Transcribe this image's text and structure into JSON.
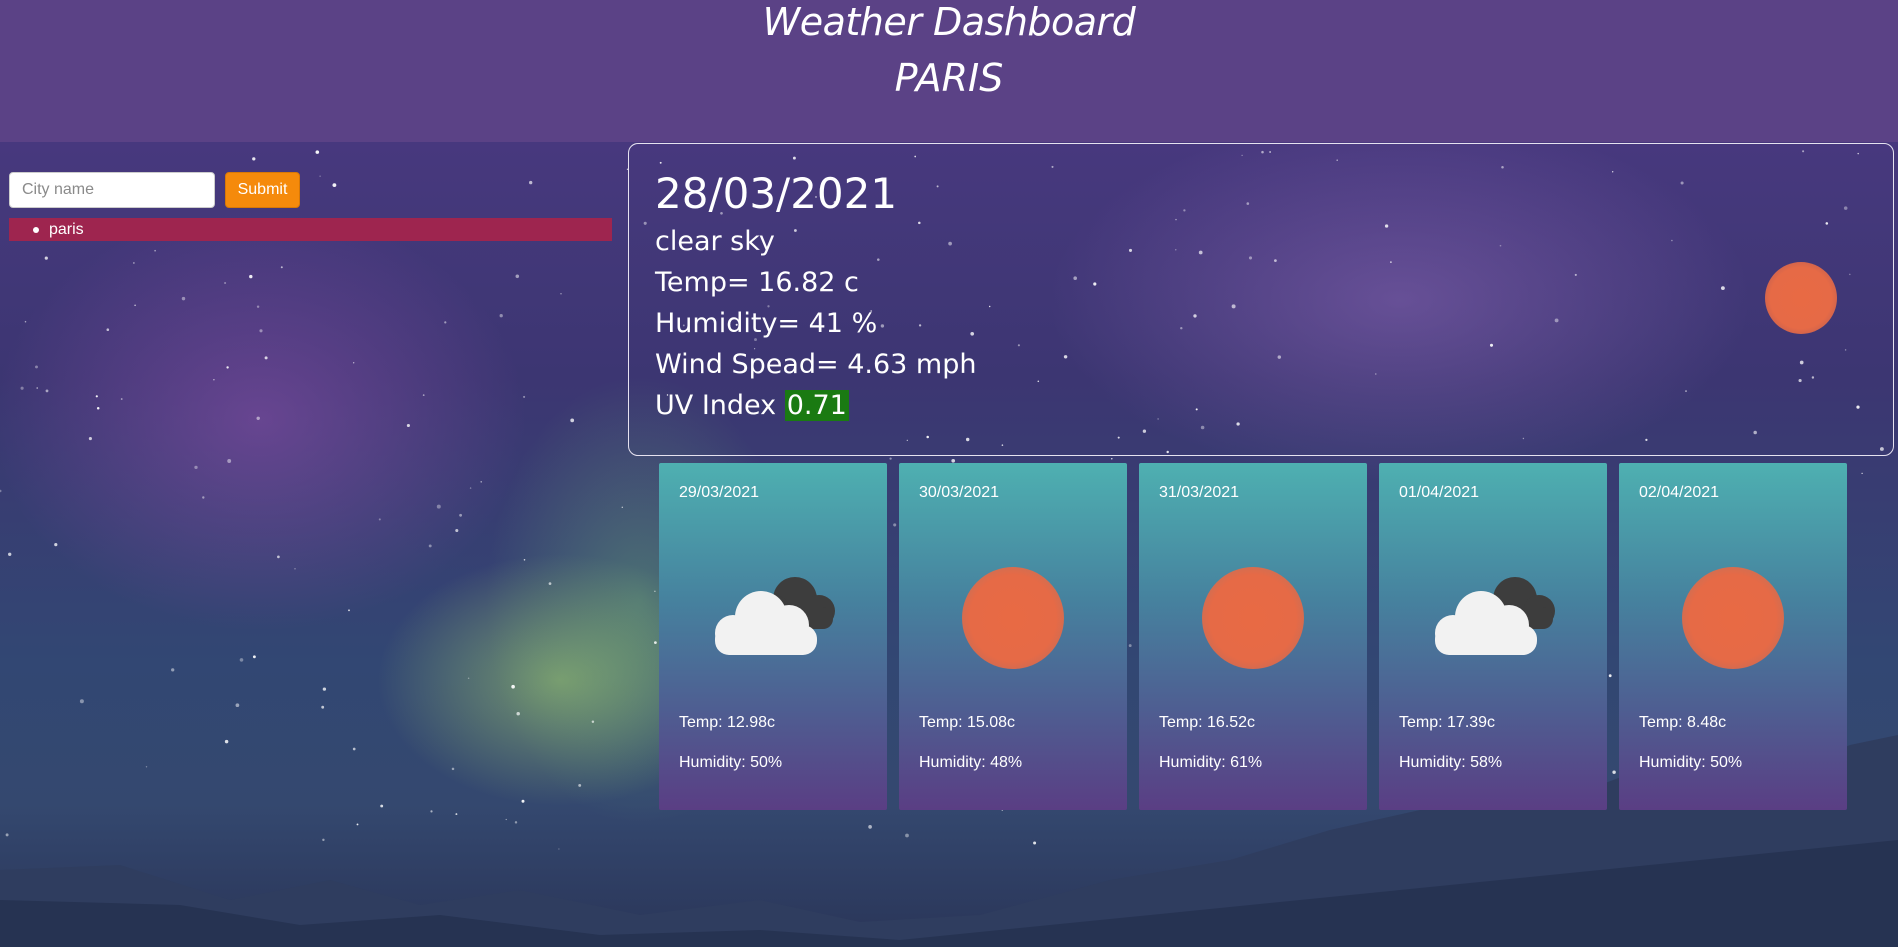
{
  "header": {
    "title": "Weather Dashboard",
    "city": "PARIS"
  },
  "search": {
    "placeholder": "City name",
    "submit_label": "Submit"
  },
  "history": [
    "paris"
  ],
  "current": {
    "date": "28/03/2021",
    "description": "clear sky",
    "temp": "Temp= 16.82 c",
    "humidity": "Humidity= 41 %",
    "wind": "Wind Spead= 4.63 mph",
    "uv_label": "UV Index ",
    "uv_value": "0.71",
    "icon": "sun-icon"
  },
  "forecast": [
    {
      "date": "29/03/2021",
      "icon": "cloud-icon",
      "temp": "Temp: 12.98c",
      "humidity": "Humidity: 50%"
    },
    {
      "date": "30/03/2021",
      "icon": "sun-icon",
      "temp": "Temp: 15.08c",
      "humidity": "Humidity: 48%"
    },
    {
      "date": "31/03/2021",
      "icon": "sun-icon",
      "temp": "Temp: 16.52c",
      "humidity": "Humidity: 61%"
    },
    {
      "date": "01/04/2021",
      "icon": "cloud-icon",
      "temp": "Temp: 17.39c",
      "humidity": "Humidity: 58%"
    },
    {
      "date": "02/04/2021",
      "icon": "sun-icon",
      "temp": "Temp: 8.48c",
      "humidity": "Humidity: 50%"
    }
  ],
  "colors": {
    "header": "#5b4286",
    "submit": "#f58a0b",
    "history_bar": "#9e254f",
    "uv_badge": "#1a7a12",
    "sun": "#e66a46"
  }
}
